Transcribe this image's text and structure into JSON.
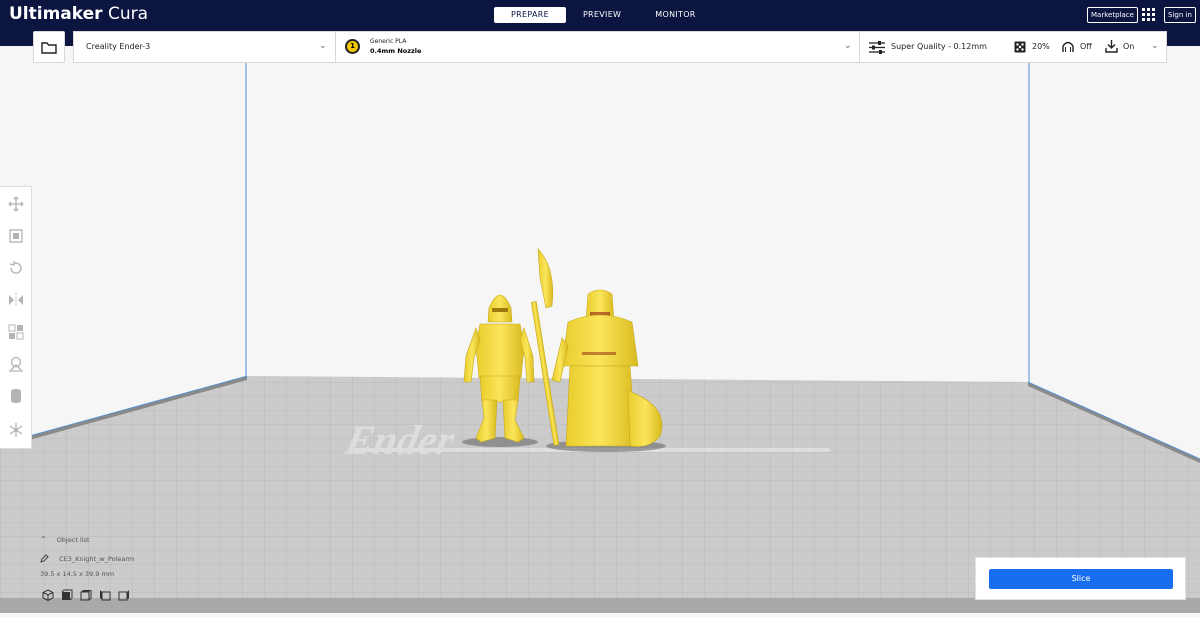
{
  "app": {
    "title_bold": "Ultimaker",
    "title_light": "Cura"
  },
  "stages": [
    {
      "label": "PREPARE",
      "active": true
    },
    {
      "label": "PREVIEW",
      "active": false
    },
    {
      "label": "MONITOR",
      "active": false
    }
  ],
  "header": {
    "marketplace_label": "Marketplace",
    "signin_label": "Sign in"
  },
  "printer": {
    "name": "Creality Ender-3"
  },
  "material": {
    "extruder_index": "1",
    "name": "Generic PLA",
    "nozzle": "0.4mm Nozzle"
  },
  "print_settings": {
    "profile": "Super Quality - 0.12mm",
    "infill": "20%",
    "support": "Off",
    "adhesion": "On"
  },
  "object_list": {
    "header": "Object list",
    "item_name": "CE3_Knight_w_Polearm",
    "dimensions": "39.5 x 14.5 x 39.9 mm"
  },
  "action": {
    "slice_label": "Slice"
  },
  "colors": {
    "topbar": "#0c1440",
    "accent": "#196ef0",
    "model": "#f7e34a",
    "buildplate": "#c9c9c9"
  }
}
